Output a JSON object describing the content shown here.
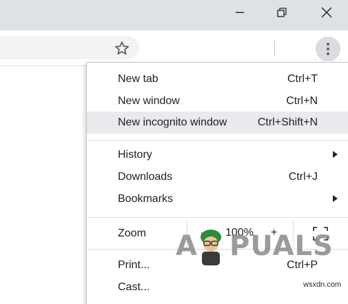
{
  "window": {
    "minimize_icon": "minimize-icon",
    "restore_icon": "restore-icon",
    "close_icon": "close-icon"
  },
  "toolbar": {
    "bookmark_icon": "star-icon",
    "menu_icon": "kebab-menu-icon"
  },
  "menu": {
    "items": [
      {
        "label": "New tab",
        "shortcut": "Ctrl+T"
      },
      {
        "label": "New window",
        "shortcut": "Ctrl+N"
      },
      {
        "label": "New incognito window",
        "shortcut": "Ctrl+Shift+N",
        "highlighted": true
      },
      {
        "label": "History",
        "submenu": true
      },
      {
        "label": "Downloads",
        "shortcut": "Ctrl+J"
      },
      {
        "label": "Bookmarks",
        "submenu": true
      },
      {
        "label": "Print...",
        "shortcut": "Ctrl+P"
      },
      {
        "label": "Cast..."
      }
    ],
    "zoom": {
      "label": "Zoom",
      "minus": "–",
      "value": "100%",
      "plus": "+",
      "fullscreen_icon": "fullscreen-icon"
    }
  },
  "watermark": {
    "text_left": "A",
    "text_right": "PUALS"
  },
  "footer": {
    "url": "wsxdn.com"
  },
  "colors": {
    "titlebar": "#dee1e6",
    "highlight": "#e8eaed",
    "divider": "#dadce0",
    "text": "#202124"
  }
}
